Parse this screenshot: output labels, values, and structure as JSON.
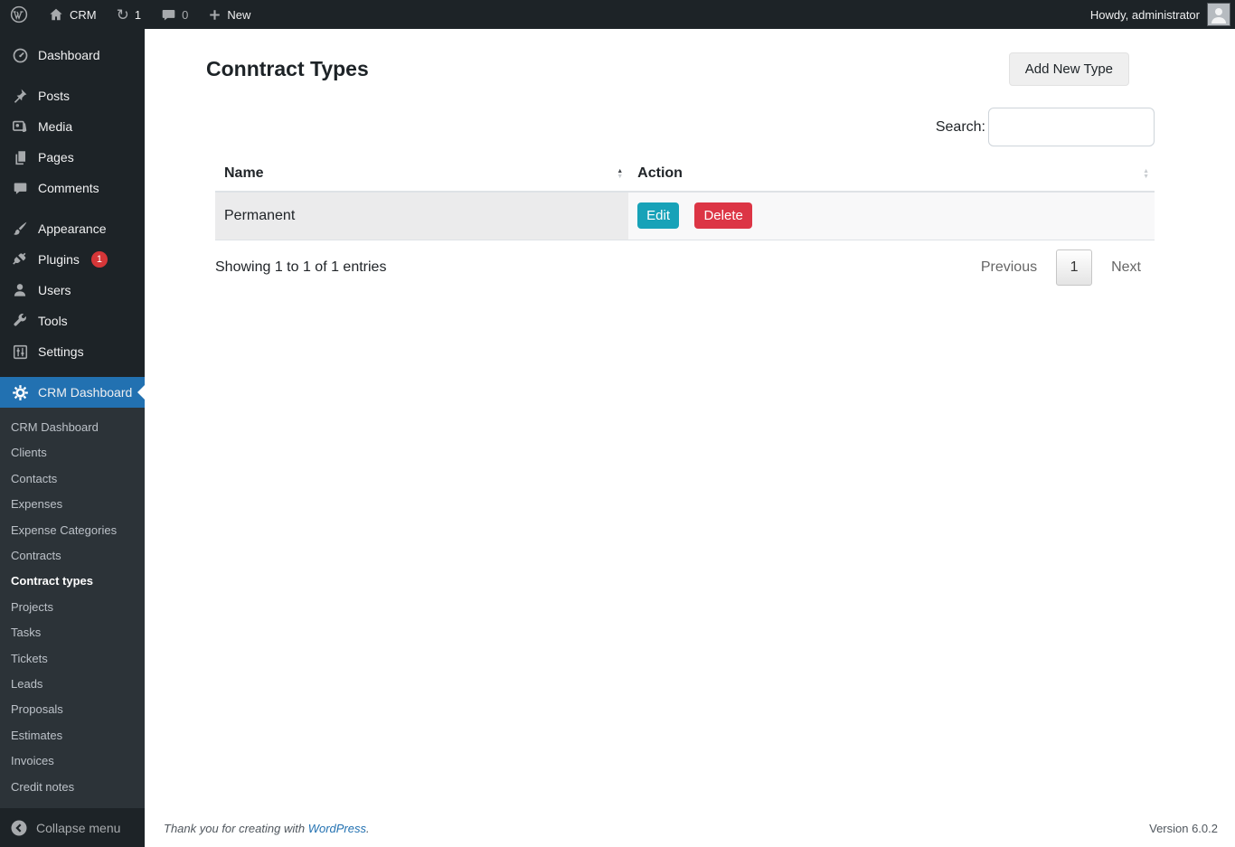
{
  "admin_bar": {
    "site_name": "CRM",
    "update_count": "1",
    "comment_count": "0",
    "new_label": "New",
    "howdy": "Howdy, administrator"
  },
  "sidebar": {
    "items": [
      {
        "label": "Dashboard"
      },
      {
        "label": "Posts"
      },
      {
        "label": "Media"
      },
      {
        "label": "Pages"
      },
      {
        "label": "Comments"
      },
      {
        "label": "Appearance"
      },
      {
        "label": "Plugins",
        "badge": "1"
      },
      {
        "label": "Users"
      },
      {
        "label": "Tools"
      },
      {
        "label": "Settings"
      },
      {
        "label": "CRM Dashboard"
      }
    ],
    "submenu": [
      {
        "label": "CRM Dashboard"
      },
      {
        "label": "Clients"
      },
      {
        "label": "Contacts"
      },
      {
        "label": "Expenses"
      },
      {
        "label": "Expense Categories"
      },
      {
        "label": "Contracts"
      },
      {
        "label": "Contract types"
      },
      {
        "label": "Projects"
      },
      {
        "label": "Tasks"
      },
      {
        "label": "Tickets"
      },
      {
        "label": "Leads"
      },
      {
        "label": "Proposals"
      },
      {
        "label": "Estimates"
      },
      {
        "label": "Invoices"
      },
      {
        "label": "Credit notes"
      }
    ],
    "collapse_label": "Collapse menu"
  },
  "main": {
    "title": "Conntract Types",
    "add_button_label": "Add New Type",
    "search_label": "Search:",
    "search_value": "",
    "table": {
      "columns": [
        "Name",
        "Action"
      ],
      "rows": [
        {
          "name": "Permanent",
          "edit_label": "Edit",
          "delete_label": "Delete"
        }
      ]
    },
    "info": "Showing 1 to 1 of 1 entries",
    "pagination": {
      "previous_label": "Previous",
      "current_page": "1",
      "next_label": "Next"
    }
  },
  "footer": {
    "thanks_text": "Thank you for creating with",
    "link_label": "WordPress",
    "period": ".",
    "version": "Version 6.0.2"
  },
  "icons": {
    "sort_asc": "▲",
    "sort_desc": "▼",
    "refresh": "↻"
  },
  "colors": {
    "sidebar_bg": "#1d2327",
    "submenu_bg": "#2c3338",
    "active_blue": "#2271b1",
    "badge_red": "#d63638",
    "edit_teal": "#17a2b8",
    "delete_red": "#dc3545"
  }
}
